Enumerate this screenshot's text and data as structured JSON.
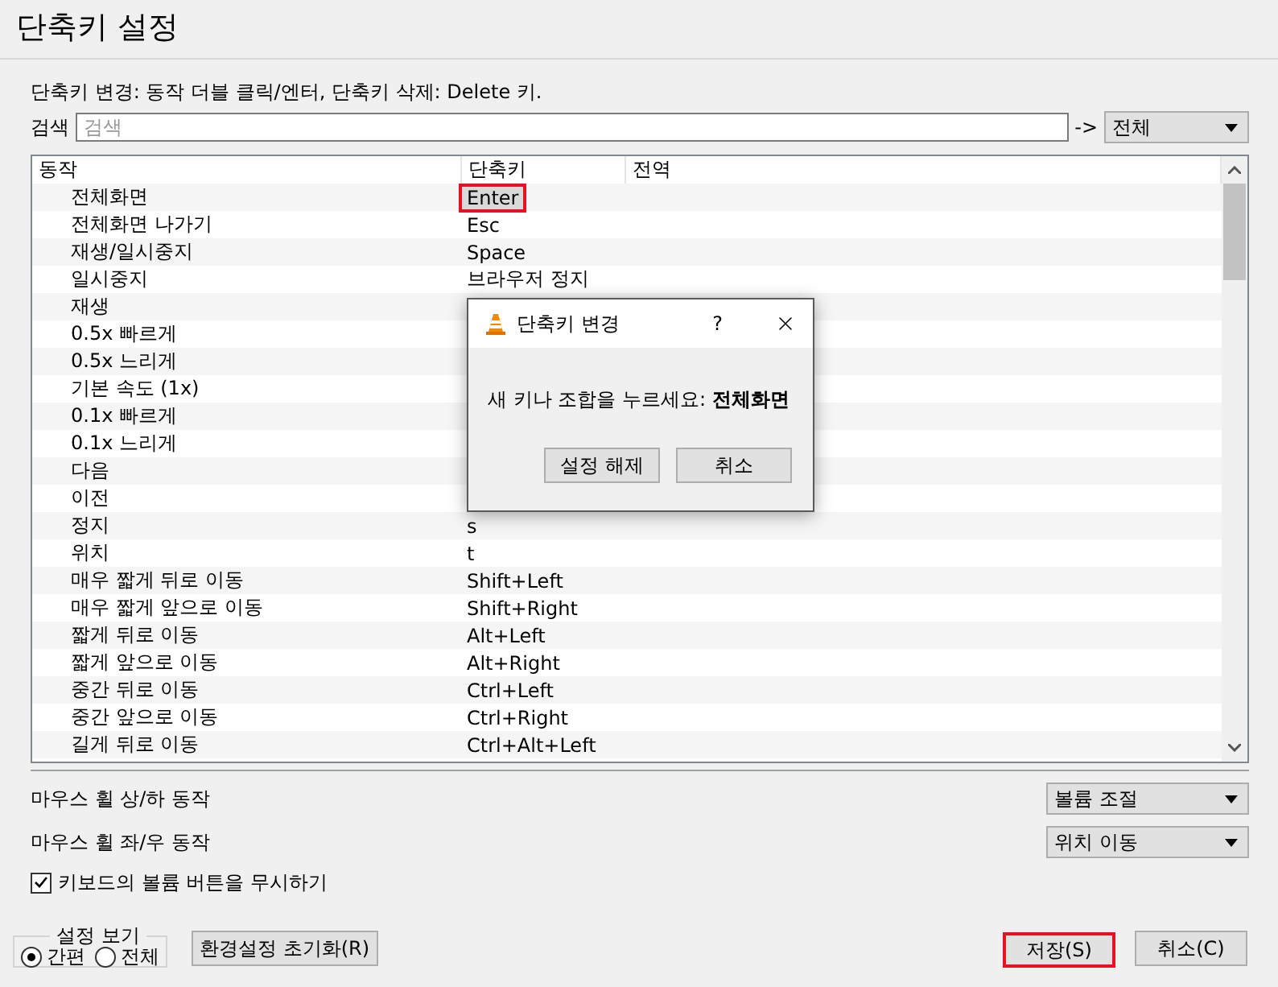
{
  "window": {
    "title": "단축키 설정"
  },
  "hint": "단축키 변경: 동작 더블 클릭/엔터, 단축키 삭제: Delete 키.",
  "search": {
    "label": "검색",
    "placeholder": "검색",
    "arrow": "->",
    "scope": "전체"
  },
  "table": {
    "columns": [
      "동작",
      "단축키",
      "전역"
    ],
    "rows": [
      {
        "action": "전체화면",
        "key": "Enter",
        "selected": true
      },
      {
        "action": "전체화면 나가기",
        "key": "Esc",
        "selected": false
      },
      {
        "action": "재생/일시중지",
        "key": "Space",
        "selected": false
      },
      {
        "action": "일시중지",
        "key": "브라우저 정지",
        "selected": false
      },
      {
        "action": "재생",
        "selected": false
      },
      {
        "action": "0.5x 빠르게",
        "selected": false
      },
      {
        "action": "0.5x 느리게",
        "selected": false
      },
      {
        "action": "기본 속도 (1x)",
        "selected": false
      },
      {
        "action": "0.1x 빠르게",
        "selected": false
      },
      {
        "action": "0.1x 느리게",
        "selected": false
      },
      {
        "action": "다음",
        "selected": false
      },
      {
        "action": "이전",
        "selected": false
      },
      {
        "action": "정지",
        "key": "s",
        "selected": false
      },
      {
        "action": "위치",
        "key": "t",
        "selected": false
      },
      {
        "action": "매우 짧게 뒤로 이동",
        "key": "Shift+Left",
        "selected": false
      },
      {
        "action": "매우 짧게 앞으로 이동",
        "key": "Shift+Right",
        "selected": false
      },
      {
        "action": "짧게 뒤로 이동",
        "key": "Alt+Left",
        "selected": false
      },
      {
        "action": "짧게 앞으로 이동",
        "key": "Alt+Right",
        "selected": false
      },
      {
        "action": "중간 뒤로 이동",
        "key": "Ctrl+Left",
        "selected": false
      },
      {
        "action": "중간 앞으로 이동",
        "key": "Ctrl+Right",
        "selected": false
      },
      {
        "action": "길게 뒤로 이동",
        "key": "Ctrl+Alt+Left",
        "selected": false
      }
    ]
  },
  "dialog": {
    "title": "단축키 변경",
    "help": "?",
    "message": "새 키나 조합을 누르세요: **전체화면**",
    "buttons": [
      "설정 해제",
      "취소"
    ]
  },
  "mouse": [
    {
      "label": "마우스 휠 상/하 동작",
      "value": "볼륨 조절"
    },
    {
      "label": "마우스 휠 좌/우 동작",
      "value": "위치 이동"
    }
  ],
  "ignore_volume_keys": {
    "label": "키보드의 볼륨 버튼을 무시하기",
    "checked": true
  },
  "view": {
    "title": "설정 보기",
    "options": [
      {
        "label": "간편",
        "selected": true
      },
      {
        "label": "전체",
        "selected": false
      }
    ]
  },
  "reset_button": "환경설정 초기화(R)",
  "buttons": [
    {
      "label": "저장(S)",
      "focused": true
    },
    {
      "label": "취소(C)",
      "focused": false
    }
  ]
}
